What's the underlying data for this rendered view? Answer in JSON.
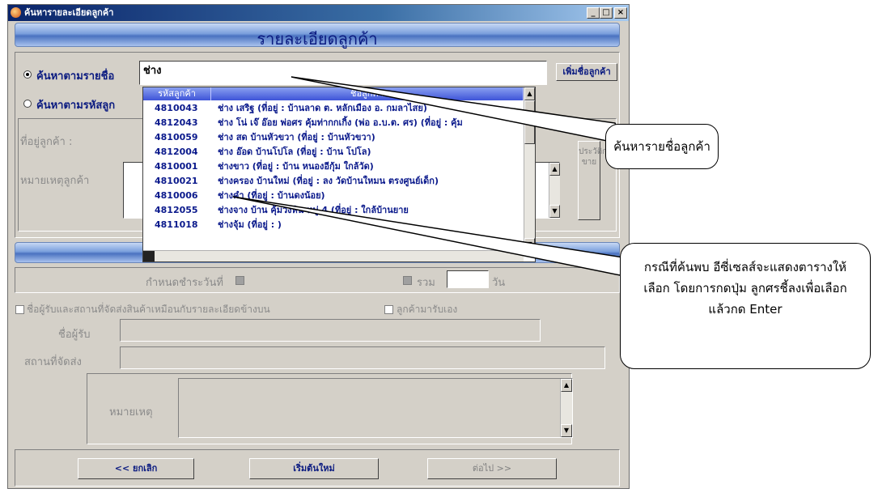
{
  "window": {
    "title": "ค้นหารายละเอียดลูกค้า"
  },
  "header": {
    "title": "รายละเอียดลูกค้า"
  },
  "search": {
    "by_name_label": "ค้นหาตามรายชื่อ",
    "by_code_label": "ค้นหาตามรหัสลูก",
    "name_value": "ช่าง",
    "add_customer_button": "เพิ่มชื่อลูกค้า"
  },
  "customer": {
    "address_label": "ที่อยู่ลูกค้า :",
    "note_label": "หมายเหตุลูกค้า",
    "history_button": "ประวัติการขาย"
  },
  "dropdown": {
    "col_code": "รหัสลูกค้า",
    "col_name": "ชื่อลูกค้า",
    "rows": [
      {
        "code": "4810043",
        "name": "ช่าง  เสริฐ  (ที่อยู่ : บ้านลาด ต. หลักเมือง อ. กมลาไสย)"
      },
      {
        "code": "4812043",
        "name": "ช่าง  โน่ เจ๊ อ๊อย  พ่อศร คุ้มท่ากกเกิ้ง  (พ่อ อ.บ.ต. ศร)  (ที่อยู่ : คุ้ม"
      },
      {
        "code": "4810059",
        "name": "ช่าง  สด  บ้านหัวขวา  (ที่อยู่ : บ้านหัวขวา)"
      },
      {
        "code": "4812004",
        "name": "ช่าง  อ๊อด   บ้านโปโล  (ที่อยู่ : บ้าน โปโล)"
      },
      {
        "code": "4810001",
        "name": "ช่างขาว  (ที่อยู่ : บ้าน หนองอีกุ้ม   ใกล้วัด)"
      },
      {
        "code": "4810021",
        "name": "ช่างครอง  บ้านใหม่  (ที่อยู่ : ลง วัดบ้านใหมน  ตรงศูนย์เด็ก)"
      },
      {
        "code": "4810006",
        "name": "ช่างคำ  (ที่อยู่ : บ้านดงน้อย)"
      },
      {
        "code": "4812055",
        "name": "ช่างจาง  บ้าน  คุ้มวังหิน  หมู่  4  (ที่อยู่ : ใกล้บ้านยาย"
      },
      {
        "code": "4811018",
        "name": "ช่างจุ้ม  (ที่อยู่ : )"
      }
    ]
  },
  "due": {
    "label": "กำหนดชำระวันที่",
    "total_label": "รวม",
    "days_label": "วัน"
  },
  "delivery": {
    "same_address_label": "ชื่อผู้รับและสถานที่จัดส่งสินค้าเหมือนกับรายละเอียดข้างบน",
    "pickup_label": "ลูกค้ามารับเอง",
    "receiver_label": "ชื่อผู้รับ",
    "place_label": "สถานที่จัดส่ง",
    "note_label": "หมายเหตุ"
  },
  "footer": {
    "cancel": "<< ยกเลิก",
    "restart": "เริ่มต้นใหม่",
    "next": "ต่อไป >>"
  },
  "callouts": {
    "search_hint": "ค้นหารายชื่อลูกค้า",
    "result_hint": "กรณีที่ค้นพบ อีซี่เซลส์จะแสดงตารางให้เลือก  โดยการกดปุ่ม ลูกศรชี้ลงเพื่อเลือก แล้วกด Enter"
  }
}
